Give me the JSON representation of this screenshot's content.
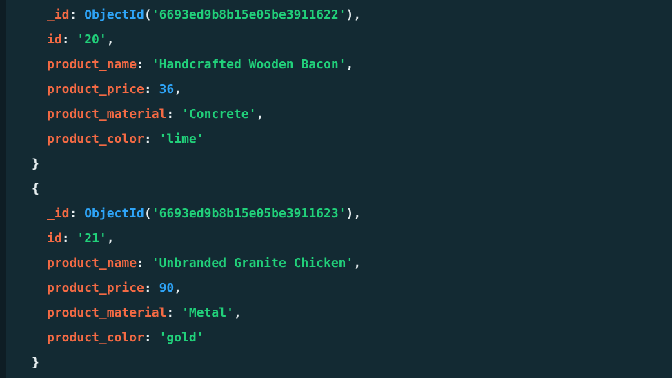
{
  "colors": {
    "background": "#132a33",
    "key": "#f36a44",
    "string": "#21d07a",
    "number": "#2ea4f7",
    "function": "#2ea4f7",
    "punctuation": "#e7eef0"
  },
  "documents": [
    {
      "_id_func": "ObjectId",
      "_id_value": "'6693ed9b8b15e05be3911622'",
      "id": "'20'",
      "product_name": "'Handcrafted Wooden Bacon'",
      "product_price": "36",
      "product_material": "'Concrete'",
      "product_color": "'lime'"
    },
    {
      "_id_func": "ObjectId",
      "_id_value": "'6693ed9b8b15e05be3911623'",
      "id": "'21'",
      "product_name": "'Unbranded Granite Chicken'",
      "product_price": "90",
      "product_material": "'Metal'",
      "product_color": "'gold'"
    }
  ],
  "keys": {
    "_id": "_id",
    "id": "id",
    "product_name": "product_name",
    "product_price": "product_price",
    "product_material": "product_material",
    "product_color": "product_color"
  },
  "punct": {
    "colon": ": ",
    "comma": ",",
    "open_brace": "{",
    "close_brace": "}",
    "open_paren": "(",
    "close_paren": ")"
  }
}
